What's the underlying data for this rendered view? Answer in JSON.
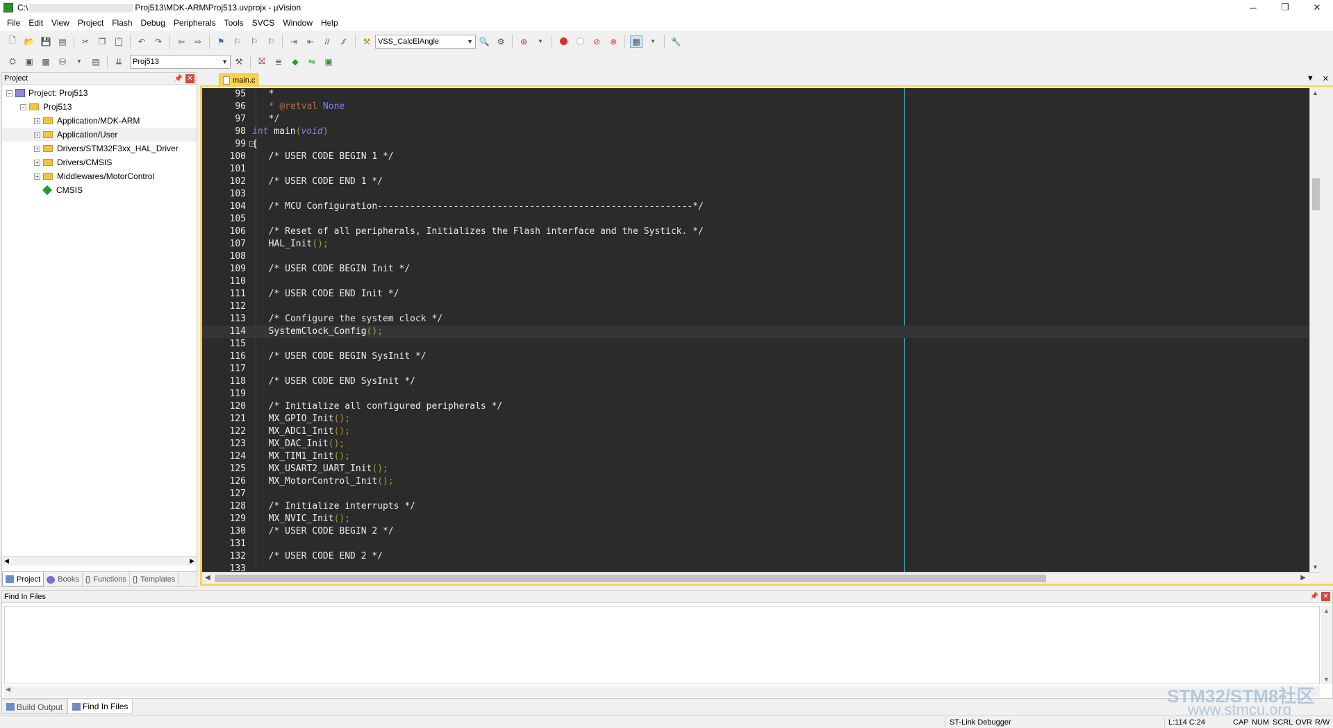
{
  "window": {
    "title_prefix": "C:\\",
    "title_suffix": "Proj513\\MDK-ARM\\Proj513.uvprojx - µVision",
    "minimize": "─",
    "restore": "❐",
    "close": "✕"
  },
  "menu": [
    "File",
    "Edit",
    "View",
    "Project",
    "Flash",
    "Debug",
    "Peripherals",
    "Tools",
    "SVCS",
    "Window",
    "Help"
  ],
  "toolbar": {
    "find_combo": "VSS_CalcElAngle",
    "target_combo": "Proj513"
  },
  "project_panel": {
    "title": "Project",
    "root": "Project: Proj513",
    "target": "Proj513",
    "groups": [
      "Application/MDK-ARM",
      "Application/User",
      "Drivers/STM32F3xx_HAL_Driver",
      "Drivers/CMSIS",
      "Middlewares/MotorControl"
    ],
    "cmsis": "CMSIS",
    "tabs": [
      "Project",
      "Books",
      "Functions",
      "Templates"
    ]
  },
  "editor": {
    "file_tab": "main.c"
  },
  "code": {
    "l95": "95",
    "l96": "96",
    "l97": "97",
    "l98": "98",
    "l99": "99",
    "l100": "100",
    "l101": "101",
    "l102": "102",
    "l103": "103",
    "l104": "104",
    "l105": "105",
    "l106": "106",
    "l107": "107",
    "l108": "108",
    "l109": "109",
    "l110": "110",
    "l111": "111",
    "l112": "112",
    "l113": "113",
    "l114": "114",
    "l115": "115",
    "l116": "116",
    "l117": "117",
    "l118": "118",
    "l119": "119",
    "l120": "120",
    "l121": "121",
    "l122": "122",
    "l123": "123",
    "l124": "124",
    "l125": "125",
    "l126": "126",
    "l127": "127",
    "l128": "128",
    "l129": "129",
    "l130": "130",
    "l131": "131",
    "l132": "132",
    "l133": "133",
    "t95": "  *",
    "t96a": "  * ",
    "t96b": "@retval",
    "t96c": " None",
    "t97": "  */",
    "t98a": "int",
    "t98b": " main",
    "t98c": "(",
    "t98d": "void",
    "t98e": ")",
    "t99": "{",
    "t100": "  /* USER CODE BEGIN 1 */",
    "t102": "  /* USER CODE END 1 */",
    "t104": "  /* MCU Configuration----------------------------------------------------------*/",
    "t106": "  /* Reset of all peripherals, Initializes the Flash interface and the Systick. */",
    "t107a": "  HAL_Init",
    "t107b": "();",
    "t109": "  /* USER CODE BEGIN Init */",
    "t111": "  /* USER CODE END Init */",
    "t113": "  /* Configure the system clock */",
    "t114a": "  SystemClock_Config",
    "t114b": "();",
    "t116": "  /* USER CODE BEGIN SysInit */",
    "t118": "  /* USER CODE END SysInit */",
    "t120": "  /* Initialize all configured peripherals */",
    "t121a": "  MX_GPIO_Init",
    "t121b": "();",
    "t122a": "  MX_ADC1_Init",
    "t122b": "();",
    "t123a": "  MX_DAC_Init",
    "t123b": "();",
    "t124a": "  MX_TIM1_Init",
    "t124b": "();",
    "t125a": "  MX_USART2_UART_Init",
    "t125b": "();",
    "t126a": "  MX_MotorControl_Init",
    "t126b": "();",
    "t128": "  /* Initialize interrupts */",
    "t129a": "  MX_NVIC_Init",
    "t129b": "();",
    "t130": "  /* USER CODE BEGIN 2 */",
    "t132": "  /* USER CODE END 2 */"
  },
  "find_panel": {
    "title": "Find In Files",
    "tabs": [
      "Build Output",
      "Find In Files"
    ]
  },
  "status": {
    "debugger": "ST-Link Debugger",
    "position": "L:114 C:24",
    "cap": "CAP",
    "num": "NUM",
    "scrl": "SCRL",
    "ovr": "OVR",
    "rw": "R/W"
  },
  "watermark": {
    "line1": "STM32/STM8社区",
    "line2": "www.stmcu.org"
  },
  "colors": {
    "editor_bg": "#2b2b2b",
    "comment": "#7c83f0",
    "paren": "#a89a2c",
    "tab_accent": "#ffd24d",
    "guide": "#40c8c8"
  }
}
